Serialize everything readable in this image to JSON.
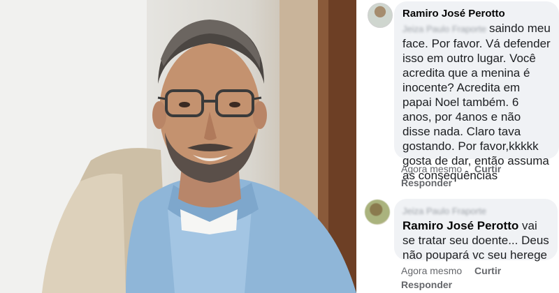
{
  "comments": [
    {
      "author": "Ramiro José Perotto",
      "mention": "Jeiza Paulo Fraporte",
      "text": "saindo meu face. Por favor. Vá defender isso em outro lugar. Você acredita que a menina é inocente? Acredita em papai Noel também. 6 anos, por 4anos e não disse nada. Claro tava gostando. Por favor,kkkkk gosta de dar, então assuma as consequências",
      "time": "Agora mesmo",
      "like": "Curtir",
      "reply": "Responder"
    },
    {
      "author": "Jeiza Paulo Fraporte",
      "tag": "Ramiro José Perotto",
      "text": "vai se tratar seu doente... Deus não poupará vc seu herege",
      "time": "Agora mesmo",
      "like": "Curtir",
      "reply": "Responder"
    }
  ],
  "colors": {
    "bubble": "#f0f2f5",
    "meta_text": "#65676b",
    "body_text": "#1c1e21"
  }
}
